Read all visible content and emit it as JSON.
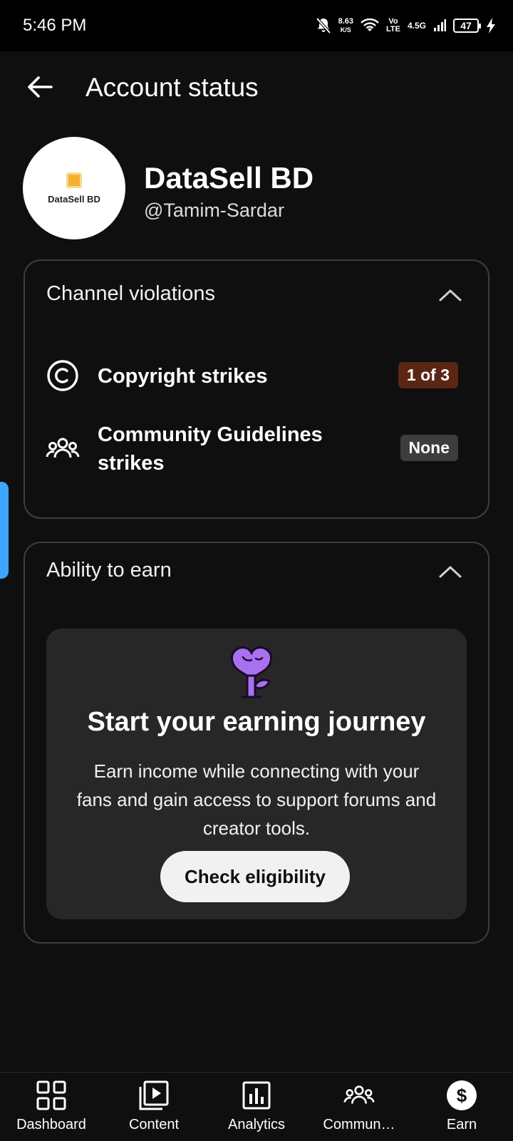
{
  "status_bar": {
    "time": "5:46 PM",
    "speed_value": "8.63",
    "speed_unit": "K/S",
    "volte_top": "Vo",
    "volte_bottom": "LTE",
    "network": "4.5G",
    "battery": "47"
  },
  "header": {
    "title": "Account status"
  },
  "channel": {
    "avatar_text": "DataSell BD",
    "name": "DataSell BD",
    "handle": "@Tamim-Sardar"
  },
  "violations": {
    "title": "Channel violations",
    "items": [
      {
        "icon": "copyright-icon",
        "label": "Copyright strikes",
        "badge": "1 of 3"
      },
      {
        "icon": "community-icon",
        "label_line1": "Community Guidelines",
        "label_line2": "strikes",
        "badge": "None"
      }
    ]
  },
  "earn": {
    "title": "Ability to earn",
    "promo_title": "Start your earning journey",
    "promo_text": "Earn income while connecting with your fans and gain access to support forums and creator tools.",
    "button": "Check eligibility",
    "illustration": "purple-heart-plant-icon"
  },
  "nav": [
    {
      "label": "Dashboard",
      "icon": "dashboard-icon"
    },
    {
      "label": "Content",
      "icon": "content-icon"
    },
    {
      "label": "Analytics",
      "icon": "analytics-icon"
    },
    {
      "label": "Commun…",
      "icon": "community-icon"
    },
    {
      "label": "Earn",
      "icon": "earn-dollar-icon",
      "selected": true
    }
  ],
  "colors": {
    "accent_side_tab": "#3ea6ff",
    "strike_badge": "#5a2613",
    "illustration": "#9b5de5"
  }
}
